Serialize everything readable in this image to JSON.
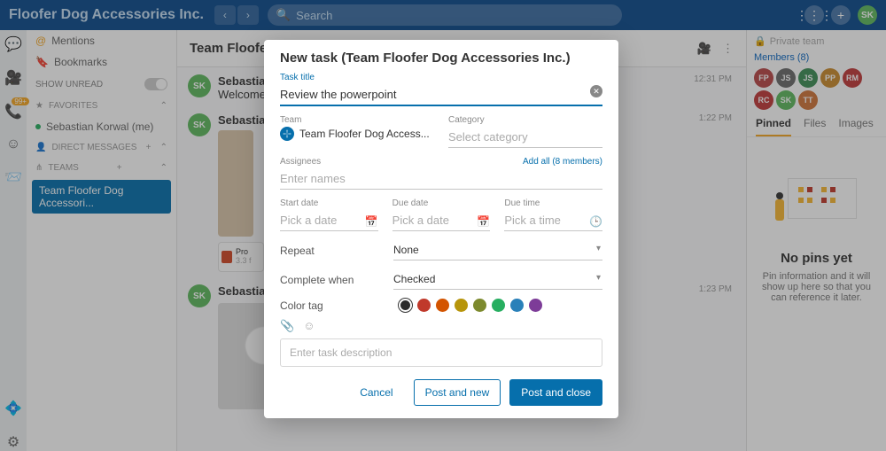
{
  "topbar": {
    "brand": "Floofer Dog Accessories Inc.",
    "search_placeholder": "Search",
    "avatar": "SK"
  },
  "leftpane": {
    "mentions": "Mentions",
    "bookmarks": "Bookmarks",
    "show_unread": "SHOW UNREAD",
    "favorites": "FAVORITES",
    "fav_item": "Sebastian Korwal (me)",
    "direct_messages": "DIRECT MESSAGES",
    "teams": "TEAMS",
    "team_active": "Team Floofer Dog Accessori..."
  },
  "chat": {
    "title": "Team Floofer Dog Accessories Inc.",
    "member_count": "8",
    "messages": [
      {
        "avatar": "SK",
        "name": "Sebastian Ko",
        "text": "Welcome tea",
        "ts": "12:31 PM"
      },
      {
        "avatar": "SK",
        "name": "Sebastian Ko",
        "text": "",
        "ts": "1:22 PM",
        "file_label": "Pro",
        "file_size": "3.3 f"
      },
      {
        "avatar": "SK",
        "name": "Sebastian Ko",
        "text": "",
        "ts": "1:23 PM"
      }
    ]
  },
  "rpane": {
    "private": "Private team",
    "members_label": "Members (8)",
    "avatars": [
      {
        "t": "FP",
        "c": "#b94747"
      },
      {
        "t": "JS",
        "c": "#6a6a6a"
      },
      {
        "t": "JS",
        "c": "#3e8e57"
      },
      {
        "t": "PP",
        "c": "#c98a2d"
      },
      {
        "t": "RM",
        "c": "#c03a3a"
      },
      {
        "t": "RC",
        "c": "#c03a3a"
      },
      {
        "t": "SK",
        "c": "#5eb85e"
      },
      {
        "t": "TT",
        "c": "#d0753a"
      }
    ],
    "tabs": [
      "Pinned",
      "Files",
      "Images"
    ],
    "pins_title": "No pins yet",
    "pins_text": "Pin information and it will show up here so that you can reference it later."
  },
  "modal": {
    "title": "New task (Team Floofer Dog Accessories Inc.)",
    "task_title_label": "Task title",
    "task_title_value": "Review the powerpoint",
    "team_label": "Team",
    "team_value": "Team Floofer Dog Access...",
    "category_label": "Category",
    "category_placeholder": "Select category",
    "assignees_label": "Assignees",
    "addall": "Add all (8 members)",
    "assignees_placeholder": "Enter names",
    "start_date_label": "Start date",
    "due_date_label": "Due date",
    "due_time_label": "Due time",
    "pick_date": "Pick a date",
    "pick_time": "Pick a time",
    "repeat_label": "Repeat",
    "repeat_value": "None",
    "complete_label": "Complete when",
    "complete_value": "Checked",
    "color_label": "Color tag",
    "colors": [
      "#2b2b2b",
      "#c0392b",
      "#d35400",
      "#b7950b",
      "#7d8a2e",
      "#27ae60",
      "#2980b9",
      "#7d3c98"
    ],
    "desc_placeholder": "Enter task description",
    "cancel": "Cancel",
    "post_new": "Post and new",
    "post_close": "Post and close"
  }
}
